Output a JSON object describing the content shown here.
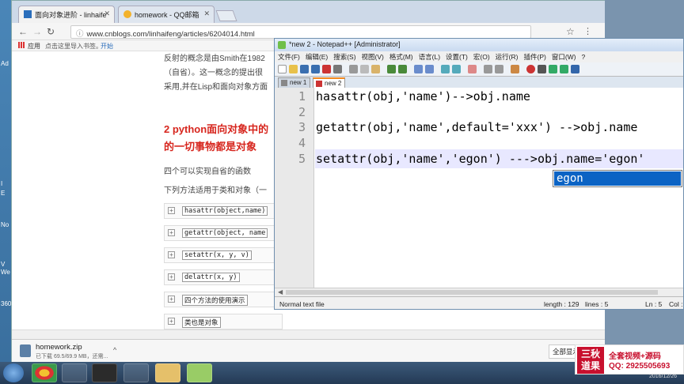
{
  "desktop": {
    "side_chars": [
      "Ad",
      "I",
      "E",
      "No",
      "V",
      "We",
      "360"
    ]
  },
  "browser": {
    "tabs": [
      {
        "label": "面向对象进阶 - linhaife"
      },
      {
        "label": "homework - QQ邮箱"
      }
    ],
    "url": "www.cnblogs.com/linhaifeng/articles/6204014.html",
    "bookmarks": {
      "apps": "应用",
      "hint": "点击这里导入书签。",
      "start": "开始"
    },
    "page": {
      "intro": [
        "反射的概念是由Smith在1982",
        "（自省）。这一概念的提出很",
        "采用,并在Lisp和面向对象方面"
      ],
      "heading_lines": [
        "2 python面向对象中的",
        "的一切事物都是对象"
      ],
      "sub1": "四个可以实现自省的函数",
      "sub2": "下列方法适用于类和对象（一",
      "functions": [
        "hasattr(object,name)",
        "getattr(object, name",
        "setattr(x, y, v)",
        "delattr(x, y)"
      ],
      "demo_label": "四个方法的使用演示",
      "class_label": "类也是对象"
    },
    "download": {
      "filename": "homework.zip",
      "status": "已下载 69.5/69.9 MB，还需...",
      "show_all": "全部显示"
    }
  },
  "notepad": {
    "title": "*new 2 - Notepad++ [Administrator]",
    "menu": [
      "文件(F)",
      "编辑(E)",
      "搜索(S)",
      "视图(V)",
      "格式(M)",
      "语言(L)",
      "设置(T)",
      "宏(O)",
      "运行(R)",
      "插件(P)",
      "窗口(W)",
      "?"
    ],
    "tabs": [
      "new 1",
      "new 2"
    ],
    "lines": [
      {
        "num": "1",
        "text": "hasattr(obj,'name')-->obj.name"
      },
      {
        "num": "2",
        "text": ""
      },
      {
        "num": "3",
        "text": "getattr(obj,'name',default='xxx') -->obj.name"
      },
      {
        "num": "4",
        "text": ""
      },
      {
        "num": "5",
        "text": "setattr(obj,'name','egon') --->obj.name='egon'"
      }
    ],
    "autocomplete": "egon",
    "status": {
      "type": "Normal text file",
      "length": "length : 129",
      "lines": "lines : 5",
      "ln": "Ln : 5",
      "col": "Col :"
    }
  },
  "watermark": {
    "logo_line1": "三秋",
    "logo_line2": "道果",
    "line1": "全套视频+源码",
    "line2": "QQ: 2925505693"
  },
  "clock": "2016/12/26"
}
